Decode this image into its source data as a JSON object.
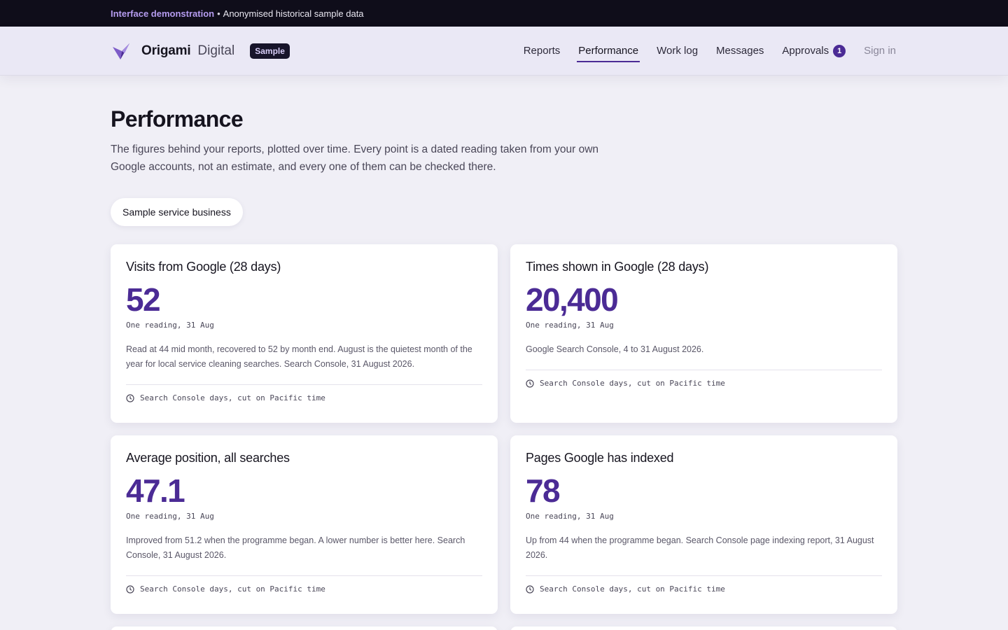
{
  "banner": {
    "accent": "Interface demonstration",
    "separator": "•",
    "text": "Anonymised historical sample data"
  },
  "header": {
    "brand_name": "Origami",
    "brand_sub": "Digital",
    "badge": "Sample",
    "nav": [
      {
        "label": "Reports"
      },
      {
        "label": "Performance",
        "active": true
      },
      {
        "label": "Work log"
      },
      {
        "label": "Messages"
      },
      {
        "label": "Approvals",
        "count": "1"
      },
      {
        "label": "Sign in"
      }
    ]
  },
  "main": {
    "title": "Performance",
    "intro": "The figures behind your reports, plotted over time. Every point is a dated reading taken from your own Google accounts, not an estimate, and every one of them can be checked there.",
    "business_chip": "Sample service business",
    "cards": [
      {
        "title": "Visits from Google (28 days)",
        "value": "52",
        "reading": "One reading, 31 Aug",
        "description": "Read at 44 mid month, recovered to 52 by month end. August is the quietest month of the year for local service cleaning searches. Search Console, 31 August 2026.",
        "footnote": "Search Console days, cut on Pacific time"
      },
      {
        "title": "Times shown in Google (28 days)",
        "value": "20,400",
        "reading": "One reading, 31 Aug",
        "description": "Google Search Console, 4 to 31 August 2026.",
        "footnote": "Search Console days, cut on Pacific time"
      },
      {
        "title": "Average position, all searches",
        "value": "47.1",
        "reading": "One reading, 31 Aug",
        "description": "Improved from 51.2 when the programme began. A lower number is better here. Search Console, 31 August 2026.",
        "footnote": "Search Console days, cut on Pacific time"
      },
      {
        "title": "Pages Google has indexed",
        "value": "78",
        "reading": "One reading, 31 Aug",
        "description": "Up from 44 when the programme began. Search Console page indexing report, 31 August 2026.",
        "footnote": "Search Console days, cut on Pacific time"
      }
    ]
  },
  "colors": {
    "accent": "#4b2b95",
    "banner_bg": "#0f0d1a",
    "page_bg": "#f0eff6",
    "header_bg": "#eae8f5"
  },
  "icons": {
    "logo": "origami-fold-logo",
    "footnote": "clock-icon"
  }
}
